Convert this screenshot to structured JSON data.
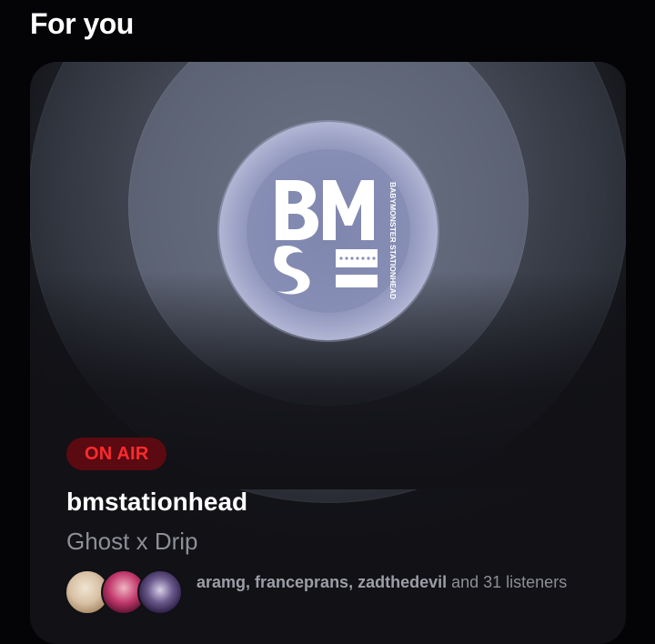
{
  "section": {
    "title": "For you"
  },
  "station": {
    "status_badge": "ON AIR",
    "name": "bmstationhead",
    "now_playing": "Ghost x Drip",
    "logo": {
      "monogram": "BM",
      "side_text": "BABYMONSTER STATIONHEAD",
      "icon": "bm-station-logo"
    },
    "listeners": {
      "names": "aramg, franceprans, zadthedevil",
      "suffix": " and 31 listeners",
      "avatars": [
        "aramg-avatar",
        "franceprans-avatar",
        "zadthedevil-avatar"
      ]
    }
  },
  "colors": {
    "background": "#040406",
    "card": "#111116",
    "on_air_text": "#ff2a2f",
    "on_air_bg": "#5a0a10",
    "secondary_text": "#8d8f97",
    "logo_ring": "#858cb3"
  }
}
